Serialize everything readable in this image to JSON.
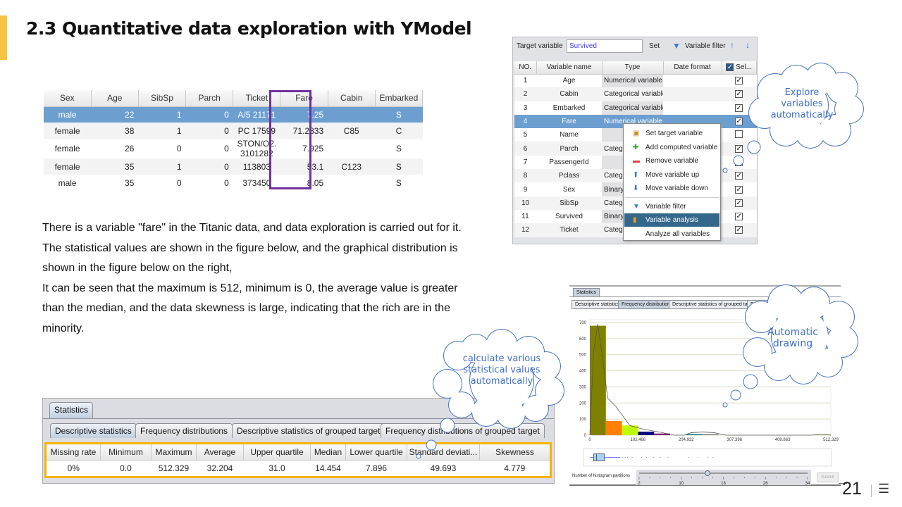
{
  "title": "2.3 Quantitative data exploration with YModel",
  "titanic": {
    "columns": [
      "Sex",
      "Age",
      "SibSp",
      "Parch",
      "Ticket",
      "Fare",
      "Cabin",
      "Embarked"
    ],
    "rows": [
      [
        "male",
        "22",
        "1",
        "0",
        "A/5 21171",
        "7.25",
        "",
        "S"
      ],
      [
        "female",
        "38",
        "1",
        "0",
        "PC 17599",
        "71.2833",
        "C85",
        "C"
      ],
      [
        "female",
        "26",
        "0",
        "0",
        "STON/O2. 3101282",
        "7.925",
        "",
        "S"
      ],
      [
        "female",
        "35",
        "1",
        "0",
        "113803",
        "53.1",
        "C123",
        "S"
      ],
      [
        "male",
        "35",
        "0",
        "0",
        "373450",
        "8.05",
        "",
        "S"
      ]
    ]
  },
  "paragraph": [
    "There is a variable \"fare\" in the Titanic data, and data exploration is carried out for it.",
    "The statistical values are shown in the figure below, and the graphical distribution is shown in the figure below on the right,",
    "It can be seen that the maximum is 512, minimum is 0, the average value is greater than the median, and the data skewness is large, indicating that the rich are in the minority."
  ],
  "stats": {
    "tab": "Statistics",
    "subtabs": [
      "Descriptive statistics",
      "Frequency distributions",
      "Descriptive statistics of grouped target",
      "Frequency distributions of grouped target"
    ],
    "columns": [
      "Missing rate",
      "Minimum",
      "Maximum",
      "Average",
      "Upper quartile",
      "Median",
      "Lower quartile",
      "Standard deviati...",
      "Skewness"
    ],
    "values": [
      "0%",
      "0.0",
      "512.329",
      "32.204",
      "31.0",
      "14.454",
      "7.896",
      "49.693",
      "4.779"
    ]
  },
  "variables": {
    "target_label": "Target variable",
    "target_value": "Survived",
    "set_label": "Set",
    "filter_label": "Variable filter",
    "columns": [
      "NO.",
      "Variable name",
      "Type",
      "Date format",
      "Sel..."
    ],
    "rows": [
      {
        "no": "1",
        "name": "Age",
        "type": "Numerical variable",
        "checked": true
      },
      {
        "no": "2",
        "name": "Cabin",
        "type": "Categorical variable",
        "checked": true
      },
      {
        "no": "3",
        "name": "Embarked",
        "type": "Categorical variable",
        "checked": true
      },
      {
        "no": "4",
        "name": "Fare",
        "type": "Numerical variable",
        "checked": true
      },
      {
        "no": "5",
        "name": "Name",
        "type": "",
        "checked": false
      },
      {
        "no": "6",
        "name": "Parch",
        "type": "Categorical variable",
        "checked": true
      },
      {
        "no": "7",
        "name": "PassengerId",
        "type": "",
        "checked": true
      },
      {
        "no": "8",
        "name": "Pclass",
        "type": "Categorical variable",
        "checked": true
      },
      {
        "no": "9",
        "name": "Sex",
        "type": "Binary variable",
        "checked": true
      },
      {
        "no": "10",
        "name": "SibSp",
        "type": "Categorical variable",
        "checked": true
      },
      {
        "no": "11",
        "name": "Survived",
        "type": "Binary variable",
        "checked": true
      },
      {
        "no": "12",
        "name": "Ticket",
        "type": "Categorical variable",
        "checked": true
      }
    ],
    "menu": [
      {
        "label": "Set target variable",
        "icon": "target-icon"
      },
      {
        "label": "Add computed variable",
        "icon": "plus-icon"
      },
      {
        "label": "Remove variable",
        "icon": "minus-icon"
      },
      {
        "label": "Move variable up",
        "icon": "arrow-up-icon"
      },
      {
        "label": "Move variable down",
        "icon": "arrow-down-icon"
      },
      {
        "label": "Variable filter",
        "icon": "filter-icon"
      },
      {
        "label": "Variable analysis",
        "icon": "bar-chart-icon"
      },
      {
        "label": "Analyze all variables",
        "icon": ""
      }
    ]
  },
  "freq_panel": {
    "tab": "Statistics",
    "subtabs": [
      "Descriptive statistics",
      "Frequency distributions",
      "Descriptive statistics of grouped target",
      "Frequency distributi"
    ],
    "partitions_label": "Number of histogram partitions",
    "slider_ticks": [
      "2",
      "10",
      "18",
      "26",
      "34"
    ],
    "slider_value": 15,
    "slider_range": [
      2,
      34
    ],
    "submit_label": "Submit"
  },
  "chart_data": {
    "type": "bar",
    "xlim": [
      0,
      512.329
    ],
    "ylim": [
      0,
      700
    ],
    "x_ticks": [
      "0",
      "102.466",
      "204.932",
      "307.398",
      "409.863",
      "512.329"
    ],
    "y_ticks": [
      "0",
      "100",
      "200",
      "300",
      "400",
      "500",
      "600",
      "700"
    ],
    "bin_width": 34.155,
    "values": [
      680,
      88,
      60,
      22,
      10,
      0,
      5,
      3,
      0,
      0,
      0,
      0,
      0,
      0,
      3
    ],
    "colors": [
      "#808000",
      "#ff8000",
      "#c0ff00",
      "#000080",
      "#800080",
      "#ff0000",
      "#008080",
      "#808080",
      "#808080",
      "#808080",
      "#808080",
      "#808080",
      "#808080",
      "#808080",
      "#d8d890"
    ],
    "density_curve": [
      [
        0,
        0
      ],
      [
        8,
        520
      ],
      [
        17,
        690
      ],
      [
        27,
        480
      ],
      [
        38,
        230
      ],
      [
        55,
        180
      ],
      [
        70,
        120
      ],
      [
        85,
        60
      ],
      [
        110,
        40
      ],
      [
        150,
        18
      ],
      [
        180,
        0
      ],
      [
        200,
        0
      ],
      [
        215,
        15
      ],
      [
        240,
        20
      ],
      [
        265,
        15
      ],
      [
        290,
        0
      ],
      [
        470,
        0
      ],
      [
        495,
        5
      ],
      [
        512,
        0
      ]
    ],
    "boxplot": {
      "min": 0,
      "q1": 7.896,
      "median": 14.454,
      "q3": 31.0,
      "whisker_high": 65,
      "outliers": [
        70,
        75,
        80,
        90,
        110,
        120,
        135,
        150,
        165,
        210,
        230,
        250,
        262
      ]
    },
    "grid": true
  },
  "clouds": {
    "explore": "Explore variables automatically",
    "calc": "calculate various statistical values automatically",
    "draw": "Automatic drawing"
  },
  "page_number": "21",
  "colors": {
    "accent": "#f7c342",
    "fare_box": "#7030a0",
    "stats_box": "#f5b400",
    "cloud": "#3f6fcc"
  }
}
